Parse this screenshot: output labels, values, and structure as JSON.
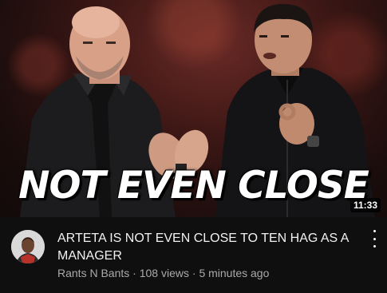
{
  "thumbnail": {
    "overlay_text": "NOT EVEN CLOSE",
    "duration": "11:33"
  },
  "video": {
    "title": "ARTETA IS NOT EVEN CLOSE TO TEN HAG AS A MANAGER",
    "channel": "Rants N Bants",
    "separator": "·",
    "views": "108 views",
    "age": "5 minutes ago"
  },
  "icons": {
    "more": "more-vert-icon",
    "avatar": "channel-avatar"
  },
  "colors": {
    "background": "#0f0f0f",
    "title": "#f1f1f1",
    "secondary": "#aaaaaa"
  }
}
